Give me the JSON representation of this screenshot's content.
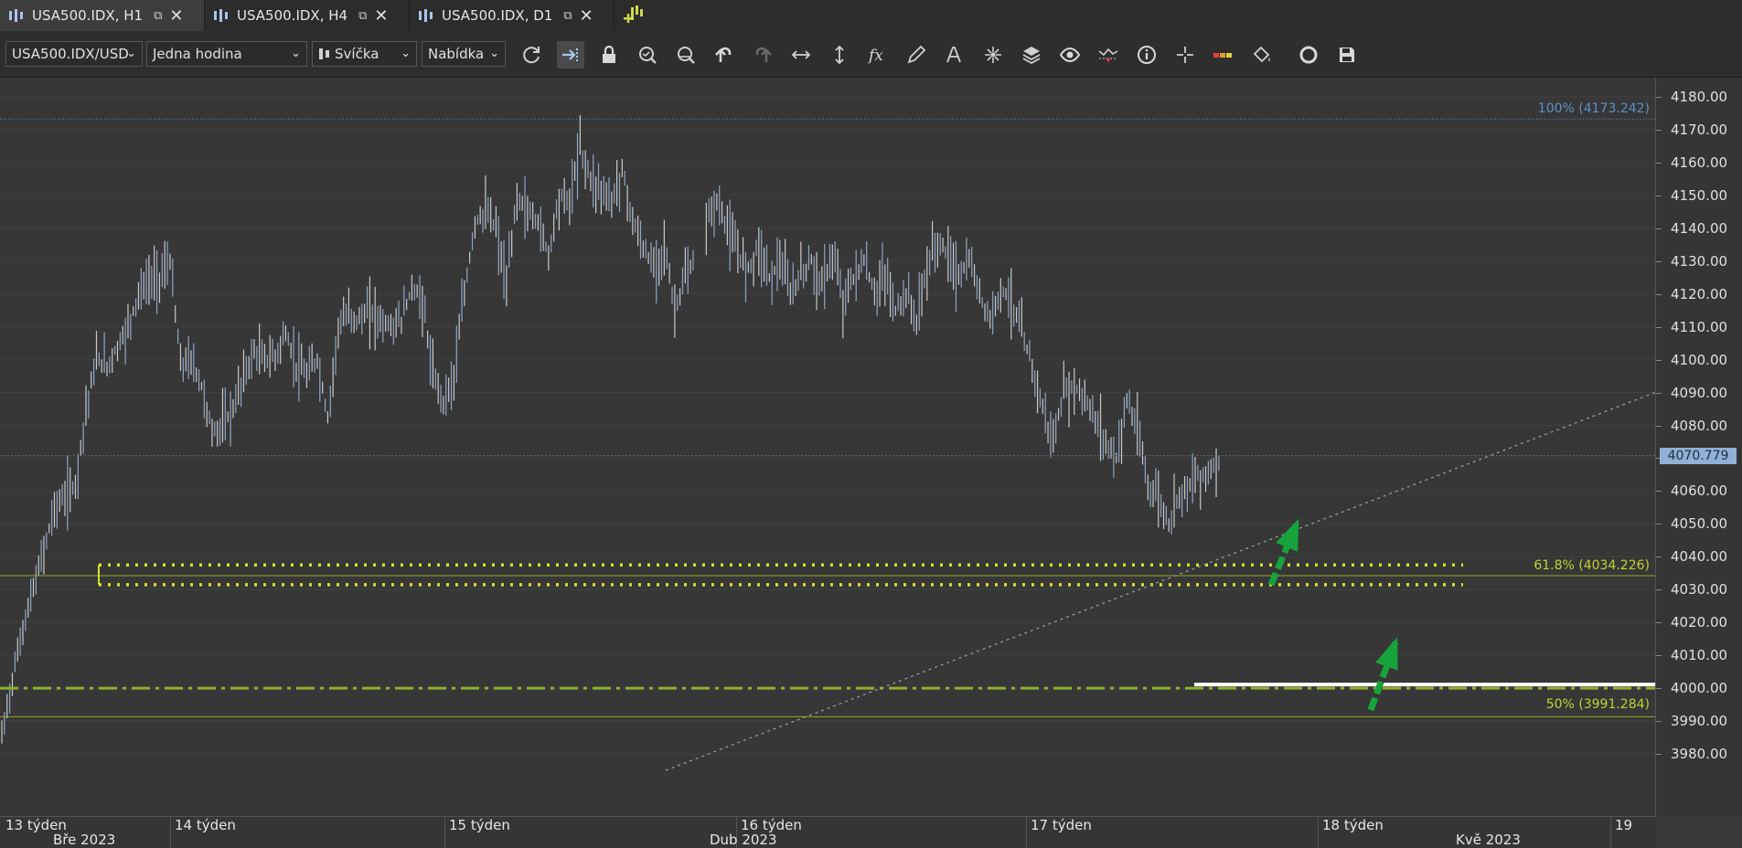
{
  "tabs": [
    {
      "label": "USA500.IDX, H1",
      "active": true
    },
    {
      "label": "USA500.IDX, H4",
      "active": false
    },
    {
      "label": "USA500.IDX, D1",
      "active": false
    }
  ],
  "toolbar": {
    "instrument": "USA500.IDX/USD",
    "period": "Jedna hodina",
    "chart_style": "Svíčka",
    "offer_side": "Nabídka",
    "tools": [
      "refresh-icon",
      "autoshift-icon",
      "lock-icon",
      "zoom-in-icon",
      "zoom-out-icon",
      "undo-icon",
      "redo-icon",
      "fit-horizontal-icon",
      "fit-vertical-icon",
      "indicators-icon",
      "pencil-icon",
      "text-icon",
      "pattern-icon",
      "layers-icon",
      "eye-icon",
      "signal-icon",
      "info-icon",
      "crosshair-icon",
      "palette-icon",
      "paint-bucket-icon",
      "circle-icon",
      "save-icon"
    ]
  },
  "colors": {
    "accent_blue": "#5f8fc8",
    "fib_yellow": "#b8cc2e",
    "dotted_yellow": "#d6e22a",
    "dash_green": "#8fb030",
    "arrow_green": "#16a33c",
    "price_tag": "#8fb1d6"
  },
  "chart_data": {
    "type": "line",
    "title": "",
    "instrument": "USA500.IDX",
    "timeframe": "H1",
    "ylim": [
      3975,
      4184
    ],
    "y_ticks": [
      3980,
      3990,
      4000,
      4010,
      4020,
      4030,
      4040,
      4050,
      4060,
      4070,
      4080,
      4090,
      4100,
      4110,
      4120,
      4130,
      4140,
      4150,
      4160,
      4170,
      4180
    ],
    "y_tick_labels": [
      "3980.00",
      "3990.00",
      "4000.00",
      "4010.00",
      "4020.00",
      "4030.00",
      "4040.00",
      "4050.00",
      "4060.00",
      "4070.00",
      "4080.00",
      "4090.00",
      "4100.00",
      "4110.00",
      "4120.00",
      "4130.00",
      "4140.00",
      "4150.00",
      "4160.00",
      "4170.00",
      "4180.00"
    ],
    "current_price": 4070.779,
    "current_price_label": "4070.779",
    "x_week_labels": [
      "13 týden",
      "14 týden",
      "15 týden",
      "16 týden",
      "17 týden",
      "18 týden",
      "19"
    ],
    "x_month_labels": [
      "Bře 2023",
      "Dub 2023",
      "Kvě 2023"
    ],
    "series": [
      {
        "x": [
          0,
          20,
          40,
          60,
          80,
          100,
          120,
          140,
          160,
          180,
          200,
          220,
          240,
          260,
          280,
          300,
          320,
          340,
          360,
          380,
          400,
          420,
          440,
          460,
          480,
          500,
          520,
          540,
          560,
          580,
          600,
          620,
          640,
          660,
          680,
          700,
          720,
          740,
          760,
          780,
          800,
          820,
          840,
          860,
          880,
          900,
          920,
          940,
          960,
          980,
          1000,
          1020,
          1040,
          1060,
          1080,
          1100,
          1120,
          1140,
          1160,
          1180,
          1200,
          1220,
          1240,
          1260,
          1280,
          1300,
          1320
        ],
        "y": [
          3985,
          4003,
          4018,
          4030,
          4042,
          4055,
          4058,
          4062,
          4085,
          4100,
          4098,
          4104,
          4110,
          4120,
          4124,
          4125,
          4130,
          4098,
          4100,
          4092,
          4078,
          4080,
          4085,
          4095,
          4102,
          4100,
          4101,
          4108,
          4098,
          4095,
          4100,
          4082,
          4110,
          4114,
          4112,
          4115,
          4112,
          4110,
          4112,
          4122,
          4118,
          4095,
          4088,
          4095,
          4120,
          4142,
          4145,
          4140,
          4122,
          4150,
          4145,
          4142,
          4132,
          4150,
          4148,
          4165,
          4155,
          4152,
          4148,
          4158,
          4142,
          4134,
          4128,
          4135,
          4115,
          4125,
          4130
        ]
      },
      {
        "x": [
          1340,
          1360,
          1380,
          1400,
          1420,
          1440,
          1460,
          1480,
          1500,
          1520,
          1540,
          1560,
          1580,
          1600,
          1620,
          1640,
          1660,
          1680,
          1700,
          1720,
          1740,
          1760,
          1780,
          1800,
          1820,
          1840,
          1860,
          1880,
          1900,
          1920,
          1940,
          1960,
          1980,
          2000,
          2020,
          2040,
          2060,
          2080,
          2100,
          2120,
          2140,
          2160,
          2180,
          2200,
          2220,
          2240,
          2260,
          2280,
          2300,
          2320
        ],
        "y": [
          4142,
          4148,
          4140,
          4132,
          4128,
          4135,
          4125,
          4130,
          4120,
          4126,
          4130,
          4122,
          4132,
          4118,
          4125,
          4130,
          4120,
          4126,
          4115,
          4120,
          4112,
          4128,
          4136,
          4132,
          4125,
          4130,
          4120,
          4112,
          4122,
          4118,
          4108,
          4098,
          4085,
          4075,
          4090,
          4092,
          4088,
          4082,
          4075,
          4070,
          4088,
          4078,
          4062,
          4058,
          4050,
          4060,
          4062,
          4065,
          4066,
          4071
        ]
      }
    ],
    "fibonacci": [
      {
        "level": "100%",
        "value": 4173.242,
        "label": "100% (4173.242)"
      },
      {
        "level": "61.8%",
        "value": 4034.226,
        "label": "61.8% (4034.226)"
      },
      {
        "level": "50%",
        "value": 3991.284,
        "label": "50% (3991.284)"
      }
    ],
    "support_zone": [
      4031.5,
      4037.5
    ],
    "support_level": 4000,
    "trendline": {
      "from_price": 3975,
      "to_price": 4090
    }
  }
}
